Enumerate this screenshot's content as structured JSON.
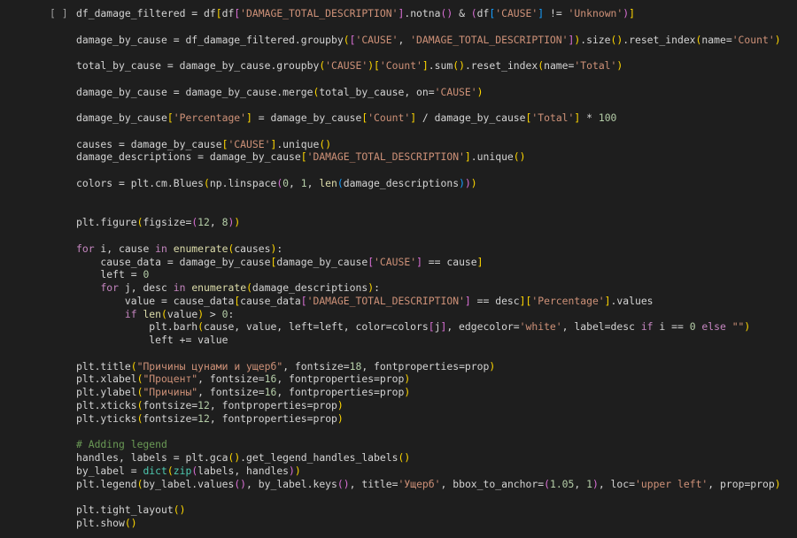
{
  "cell": {
    "run_indicator": "[ ]",
    "lines": [
      "df_damage_filtered = df[df['DAMAGE_TOTAL_DESCRIPTION'].notna() & (df['CAUSE'] != 'Unknown')]",
      "",
      "damage_by_cause = df_damage_filtered.groupby(['CAUSE', 'DAMAGE_TOTAL_DESCRIPTION']).size().reset_index(name='Count')",
      "",
      "total_by_cause = damage_by_cause.groupby('CAUSE')['Count'].sum().reset_index(name='Total')",
      "",
      "damage_by_cause = damage_by_cause.merge(total_by_cause, on='CAUSE')",
      "",
      "damage_by_cause['Percentage'] = damage_by_cause['Count'] / damage_by_cause['Total'] * 100",
      "",
      "causes = damage_by_cause['CAUSE'].unique()",
      "damage_descriptions = damage_by_cause['DAMAGE_TOTAL_DESCRIPTION'].unique()",
      "",
      "colors = plt.cm.Blues(np.linspace(0, 1, len(damage_descriptions)))",
      "",
      "",
      "plt.figure(figsize=(12, 8))",
      "",
      "for i, cause in enumerate(causes):",
      "    cause_data = damage_by_cause[damage_by_cause['CAUSE'] == cause]",
      "    left = 0",
      "    for j, desc in enumerate(damage_descriptions):",
      "        value = cause_data[cause_data['DAMAGE_TOTAL_DESCRIPTION'] == desc]['Percentage'].values",
      "        if len(value) > 0:",
      "            plt.barh(cause, value, left=left, color=colors[j], edgecolor='white', label=desc if i == 0 else \"\")",
      "            left += value",
      "",
      "plt.title(\"Причины цунами и ущерб\", fontsize=18, fontproperties=prop)",
      "plt.xlabel(\"Процент\", fontsize=16, fontproperties=prop)",
      "plt.ylabel(\"Причины\", fontsize=16, fontproperties=prop)",
      "plt.xticks(fontsize=12, fontproperties=prop)",
      "plt.yticks(fontsize=12, fontproperties=prop)",
      "",
      "# Adding legend",
      "handles, labels = plt.gca().get_legend_handles_labels()",
      "by_label = dict(zip(labels, handles))",
      "plt.legend(by_label.values(), by_label.keys(), title='Ущерб', bbox_to_anchor=(1.05, 1), loc='upper left', prop=prop)",
      "",
      "plt.tight_layout()",
      "plt.show()"
    ]
  }
}
